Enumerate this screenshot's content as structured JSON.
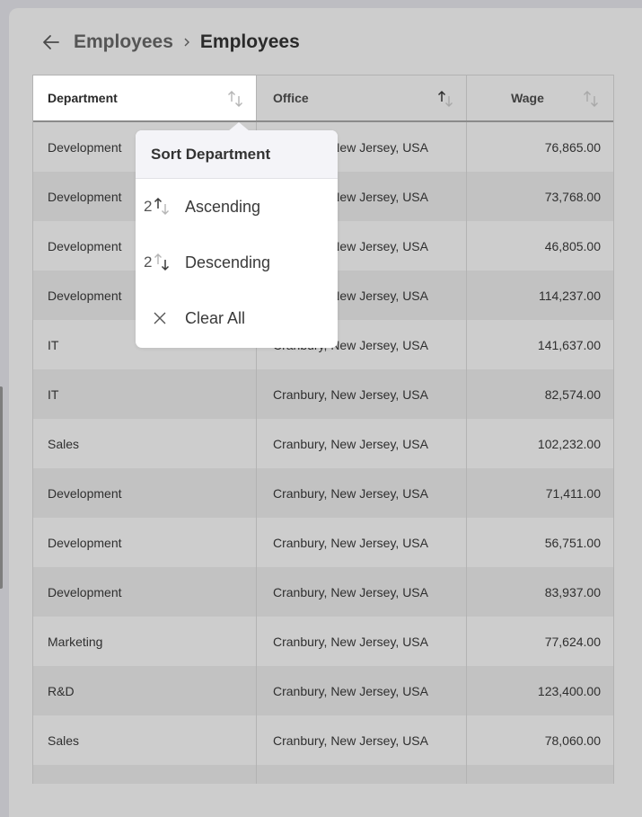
{
  "breadcrumb": {
    "back_icon": "arrow-left-icon",
    "parent": "Employees",
    "separator_icon": "chevron-right-icon",
    "current": "Employees"
  },
  "grid": {
    "columns": [
      {
        "key": "department",
        "label": "Department",
        "sort_state": "none",
        "sort_icon": "sort-arrows-icon"
      },
      {
        "key": "office",
        "label": "Office",
        "sort_state": "ascending",
        "sort_icon": "sort-arrows-icon"
      },
      {
        "key": "wage",
        "label": "Wage",
        "sort_state": "none",
        "sort_icon": "sort-arrows-icon"
      }
    ],
    "rows": [
      {
        "department": "Development",
        "office": "Cranbury, New Jersey, USA",
        "wage": "76,865.00"
      },
      {
        "department": "Development",
        "office": "Cranbury, New Jersey, USA",
        "wage": "73,768.00"
      },
      {
        "department": "Development",
        "office": "Cranbury, New Jersey, USA",
        "wage": "46,805.00"
      },
      {
        "department": "Development",
        "office": "Cranbury, New Jersey, USA",
        "wage": "114,237.00"
      },
      {
        "department": "IT",
        "office": "Cranbury, New Jersey, USA",
        "wage": "141,637.00"
      },
      {
        "department": "IT",
        "office": "Cranbury, New Jersey, USA",
        "wage": "82,574.00"
      },
      {
        "department": "Sales",
        "office": "Cranbury, New Jersey, USA",
        "wage": "102,232.00"
      },
      {
        "department": "Development",
        "office": "Cranbury, New Jersey, USA",
        "wage": "71,411.00"
      },
      {
        "department": "Development",
        "office": "Cranbury, New Jersey, USA",
        "wage": "56,751.00"
      },
      {
        "department": "Development",
        "office": "Cranbury, New Jersey, USA",
        "wage": "83,937.00"
      },
      {
        "department": "Marketing",
        "office": "Cranbury, New Jersey, USA",
        "wage": "77,624.00"
      },
      {
        "department": "R&D",
        "office": "Cranbury, New Jersey, USA",
        "wage": "123,400.00"
      },
      {
        "department": "Sales",
        "office": "Cranbury, New Jersey, USA",
        "wage": "78,060.00"
      },
      {
        "department": "",
        "office": "",
        "wage": ""
      }
    ]
  },
  "sort_popup": {
    "title": "Sort Department",
    "items": [
      {
        "label": "Ascending",
        "index": "2",
        "icon": "sort-ascending-icon"
      },
      {
        "label": "Descending",
        "index": "2",
        "icon": "sort-descending-icon"
      },
      {
        "label": "Clear All",
        "index": "",
        "icon": "close-icon"
      }
    ]
  },
  "colors": {
    "background": "#cdcdcd",
    "active_header": "#ffffff",
    "row_alt": "#c2c2c2",
    "popup_header": "#f4f4f8"
  }
}
